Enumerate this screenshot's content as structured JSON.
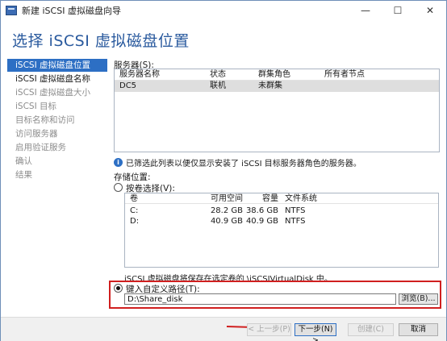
{
  "window": {
    "title": "新建 iSCSI 虚拟磁盘向导",
    "controls": [
      "—",
      "☐",
      "✕"
    ]
  },
  "header": {
    "title": "选择 iSCSI 虚拟磁盘位置"
  },
  "nav": {
    "items": [
      {
        "label": "iSCSI 虚拟磁盘位置",
        "state": "active"
      },
      {
        "label": "iSCSI 虚拟磁盘名称",
        "state": "enabled"
      },
      {
        "label": "iSCSI 虚拟磁盘大小",
        "state": "disabled"
      },
      {
        "label": "iSCSI 目标",
        "state": "disabled"
      },
      {
        "label": "目标名称和访问",
        "state": "disabled"
      },
      {
        "label": "访问服务器",
        "state": "disabled"
      },
      {
        "label": "启用验证服务",
        "state": "disabled"
      },
      {
        "label": "确认",
        "state": "disabled"
      },
      {
        "label": "结果",
        "state": "disabled"
      }
    ]
  },
  "servers": {
    "label": "服务器(S):",
    "headers": [
      "服务器名称",
      "状态",
      "群集角色",
      "所有者节点"
    ],
    "rows": [
      [
        "DC5",
        "联机",
        "未群集",
        ""
      ]
    ]
  },
  "info": {
    "icon": "info-icon",
    "text": "已筛选此列表以便仅显示安装了 iSCSI 目标服务器角色的服务器。"
  },
  "storage": {
    "label": "存储位置:",
    "by_volume_label": "按卷选择(V):",
    "by_volume_selected": false,
    "headers": [
      "卷",
      "可用空间",
      "容量",
      "文件系统"
    ],
    "rows": [
      [
        "C:",
        "28.2 GB",
        "38.6 GB",
        "NTFS"
      ],
      [
        "D:",
        "40.9 GB",
        "40.9 GB",
        "NTFS"
      ]
    ],
    "note": "iSCSI 虚拟磁盘将保存在选定卷的 \\iSCSIVirtualDisk 中。",
    "custom_path_label": "键入自定义路径(T):",
    "custom_path_selected": true,
    "custom_path_value": "D:\\Share_disk",
    "browse_label": "浏览(B)..."
  },
  "footer": {
    "prev_label": "< 上一步(P)",
    "next_label": "下一步(N) >",
    "create_label": "创建(C)",
    "cancel_label": "取消"
  },
  "colors": {
    "accent": "#2d6fc4",
    "highlight": "#d01f1f",
    "title": "#2a5a9e"
  }
}
